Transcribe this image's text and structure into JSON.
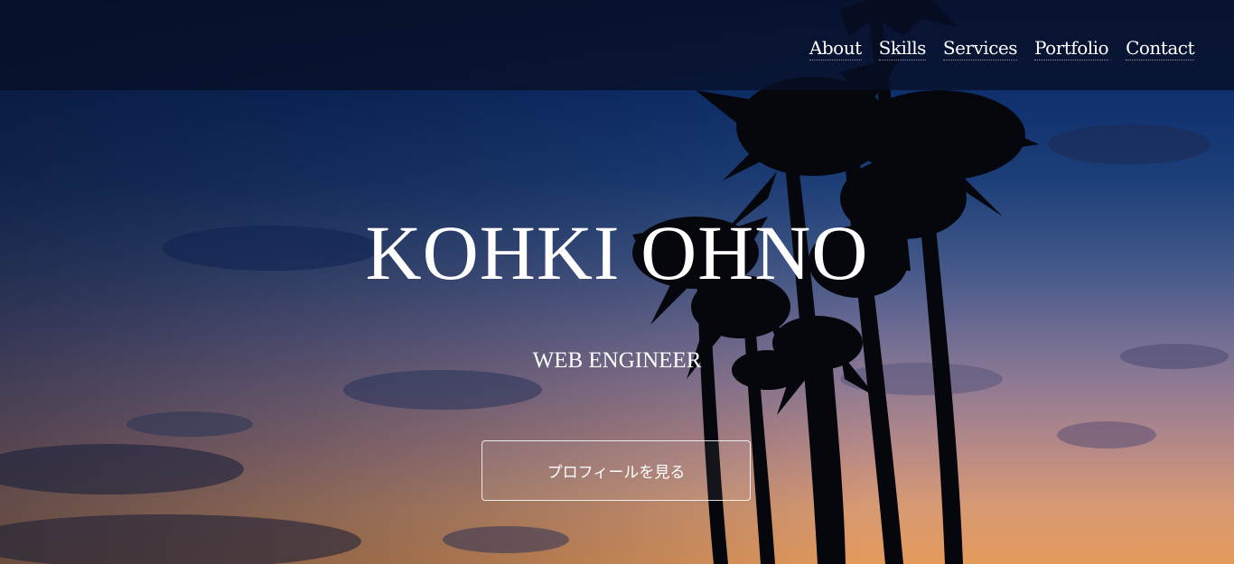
{
  "nav": {
    "items": [
      {
        "label": "About"
      },
      {
        "label": "Skills"
      },
      {
        "label": "Services"
      },
      {
        "label": "Portfolio"
      },
      {
        "label": "Contact"
      }
    ]
  },
  "hero": {
    "title": "KOHKI OHNO",
    "subtitle": "WEB ENGINEER",
    "cta_label": "プロフィールを見る"
  },
  "colors": {
    "sky_top": "#07204f",
    "sky_bottom": "#e59a5c",
    "navbar_bg": "#081026",
    "text": "#ffffff",
    "silhouette": "#06070c"
  }
}
